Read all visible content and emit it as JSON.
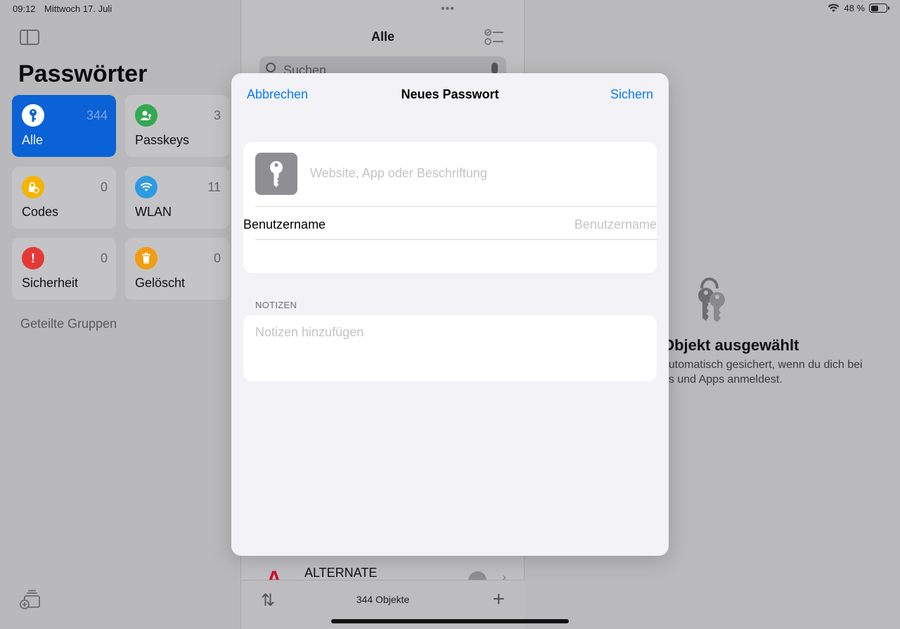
{
  "status_bar": {
    "time": "09:12",
    "date": "Mittwoch 17. Juli",
    "battery": "48 %"
  },
  "sidebar": {
    "title": "Passwörter",
    "tiles": [
      {
        "label": "Alle",
        "count": "344",
        "icon": "key-icon",
        "color": "#ffffff",
        "active": true
      },
      {
        "label": "Passkeys",
        "count": "3",
        "icon": "person-key-icon",
        "color": "#34a853"
      },
      {
        "label": "Codes",
        "count": "0",
        "icon": "lock-clock-icon",
        "color": "#f4b400"
      },
      {
        "label": "WLAN",
        "count": "11",
        "icon": "wifi-icon",
        "color": "#2d9be0"
      },
      {
        "label": "Sicherheit",
        "count": "0",
        "icon": "exclamation-icon",
        "color": "#e53935"
      },
      {
        "label": "Gelöscht",
        "count": "0",
        "icon": "trash-icon",
        "color": "#f39c12"
      }
    ],
    "shared_groups": "Geteilte Gruppen"
  },
  "list": {
    "title": "Alle",
    "search_placeholder": "Suchen",
    "row": {
      "name": "ALTERNATE",
      "logo": "A"
    },
    "count": "344 Objekte"
  },
  "detail": {
    "title": "Objekt ausgewählt",
    "subtitle": "automatisch gesichert, wenn du dich bei\nes und Apps anmeldest."
  },
  "modal": {
    "cancel": "Abbrechen",
    "title": "Neues Passwort",
    "save": "Sichern",
    "site_placeholder": "Website, App oder Beschriftung",
    "username_label": "Benutzername",
    "username_placeholder": "Benutzername",
    "notes_header": "NOTIZEN",
    "notes_placeholder": "Notizen hinzufügen"
  },
  "colors": {
    "accent": "#0a7aff",
    "active_tile": "#0a62d6"
  }
}
